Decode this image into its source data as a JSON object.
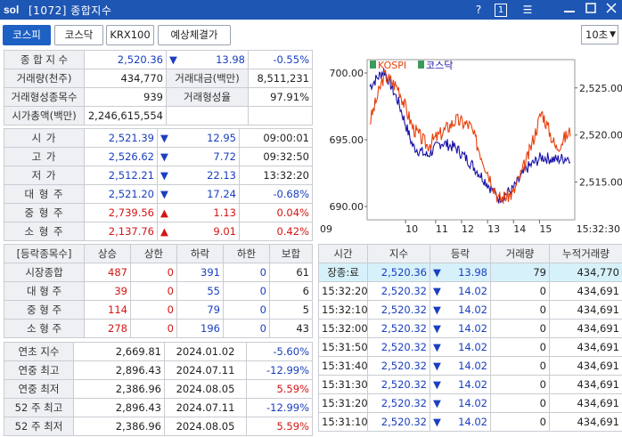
{
  "window": {
    "logo": "sol",
    "title": "[1072] 종합지수",
    "help_icon": "?",
    "one_icon": "1"
  },
  "tabs": [
    "코스피",
    "코스닥",
    "KRX100",
    "예상체결가"
  ],
  "interval": "10초",
  "summary": {
    "r1": {
      "l1": "종 합 지 수",
      "v1": "2,520.36",
      "arrow": "▼",
      "chg": "13.98",
      "pct": "-0.55%"
    },
    "r2": {
      "l1": "거래량(천주)",
      "v1": "434,770",
      "l2": "거래대금(백만)",
      "v2": "8,511,231"
    },
    "r3": {
      "l1": "거래형성종목수",
      "v1": "939",
      "l2": "거래형성율",
      "v2": "97.91%"
    },
    "r4": {
      "l1": "시가총액(백만)",
      "v1": "2,246,615,554"
    }
  },
  "prices": [
    {
      "label": "시    가",
      "val": "2,521.39",
      "arrow": "▼",
      "chg": "12.95",
      "extra": "09:00:01",
      "dir": "dn"
    },
    {
      "label": "고    가",
      "val": "2,526.62",
      "arrow": "▼",
      "chg": "7.72",
      "extra": "09:32:50",
      "dir": "dn"
    },
    {
      "label": "저    가",
      "val": "2,512.21",
      "arrow": "▼",
      "chg": "22.13",
      "extra": "13:32:20",
      "dir": "dn"
    },
    {
      "label": "대 형 주",
      "val": "2,521.20",
      "arrow": "▼",
      "chg": "17.24",
      "extra": "-0.68%",
      "dir": "dn"
    },
    {
      "label": "중 형 주",
      "val": "2,739.56",
      "arrow": "▲",
      "chg": "1.13",
      "extra": "0.04%",
      "dir": "up"
    },
    {
      "label": "소 형 주",
      "val": "2,137.76",
      "arrow": "▲",
      "chg": "9.01",
      "extra": "0.42%",
      "dir": "up"
    }
  ],
  "breadth": {
    "headers": [
      "[등락종목수]",
      "상승",
      "상한",
      "하락",
      "하한",
      "보합"
    ],
    "rows": [
      {
        "label": "시장종합",
        "v": [
          "487",
          "0",
          "391",
          "0",
          "61"
        ]
      },
      {
        "label": "대 형 주",
        "v": [
          "39",
          "0",
          "55",
          "0",
          "6"
        ]
      },
      {
        "label": "중 형 주",
        "v": [
          "114",
          "0",
          "79",
          "0",
          "5"
        ]
      },
      {
        "label": "소 형 주",
        "v": [
          "278",
          "0",
          "196",
          "0",
          "43"
        ]
      }
    ]
  },
  "yearly": [
    {
      "label": "연초  지수",
      "val": "2,669.81",
      "date": "2024.01.02",
      "pct": "-5.60%",
      "dir": "dn"
    },
    {
      "label": "연중  최고",
      "val": "2,896.43",
      "date": "2024.07.11",
      "pct": "-12.99%",
      "dir": "dn"
    },
    {
      "label": "연중  최저",
      "val": "2,386.96",
      "date": "2024.08.05",
      "pct": "5.59%",
      "dir": "up"
    },
    {
      "label": "52 주 최고",
      "val": "2,896.43",
      "date": "2024.07.11",
      "pct": "-12.99%",
      "dir": "dn"
    },
    {
      "label": "52 주 최저",
      "val": "2,386.96",
      "date": "2024.08.05",
      "pct": "5.59%",
      "dir": "up"
    }
  ],
  "ticks": {
    "headers": [
      "시간",
      "지수",
      "등락",
      "거래량",
      "누적거래량"
    ],
    "rows": [
      {
        "t": "장종:료",
        "idx": "2,520.36",
        "arrow": "▼",
        "chg": "13.98",
        "vol": "79",
        "cum": "434,770"
      },
      {
        "t": "15:32:20",
        "idx": "2,520.32",
        "arrow": "▼",
        "chg": "14.02",
        "vol": "0",
        "cum": "434,691"
      },
      {
        "t": "15:32:10",
        "idx": "2,520.32",
        "arrow": "▼",
        "chg": "14.02",
        "vol": "0",
        "cum": "434,691"
      },
      {
        "t": "15:32:00",
        "idx": "2,520.32",
        "arrow": "▼",
        "chg": "14.02",
        "vol": "0",
        "cum": "434,691"
      },
      {
        "t": "15:31:50",
        "idx": "2,520.32",
        "arrow": "▼",
        "chg": "14.02",
        "vol": "0",
        "cum": "434,691"
      },
      {
        "t": "15:31:40",
        "idx": "2,520.32",
        "arrow": "▼",
        "chg": "14.02",
        "vol": "0",
        "cum": "434,691"
      },
      {
        "t": "15:31:30",
        "idx": "2,520.32",
        "arrow": "▼",
        "chg": "14.02",
        "vol": "0",
        "cum": "434,691"
      },
      {
        "t": "15:31:20",
        "idx": "2,520.32",
        "arrow": "▼",
        "chg": "14.02",
        "vol": "0",
        "cum": "434,691"
      },
      {
        "t": "15:31:10",
        "idx": "2,520.32",
        "arrow": "▼",
        "chg": "14.02",
        "vol": "0",
        "cum": "434,691"
      }
    ]
  },
  "chart": {
    "legend": [
      "KOSPI",
      "코스닥"
    ],
    "colors": {
      "kospi": "#e8400c",
      "kosdaq": "#1a12a8"
    },
    "left_ticks": [
      "700.00",
      "695.00",
      "690.00"
    ],
    "right_ticks": [
      "2,525.00",
      "2,520.00",
      "2,515.00"
    ],
    "x_ticks": [
      "09",
      "10",
      "11",
      "12",
      "13",
      "14",
      "15",
      "15:32:30"
    ],
    "left_range": [
      689,
      701
    ],
    "right_range": [
      2511,
      2528
    ]
  },
  "chart_data": {
    "type": "line",
    "x": [
      "09:00",
      "09:30",
      "10:00",
      "10:30",
      "11:00",
      "11:30",
      "12:00",
      "12:30",
      "13:00",
      "13:30",
      "14:00",
      "14:30",
      "15:00",
      "15:20",
      "15:30"
    ],
    "series": [
      {
        "name": "KOSPI",
        "axis": "right",
        "values": [
          2521.4,
          2526.4,
          2525.0,
          2520.8,
          2518.9,
          2520.2,
          2521.6,
          2521.0,
          2517.0,
          2513.2,
          2513.8,
          2517.5,
          2522.5,
          2518.6,
          2520.4
        ]
      },
      {
        "name": "코스닥",
        "axis": "left",
        "values": [
          699.0,
          700.2,
          697.8,
          694.5,
          693.8,
          694.8,
          694.4,
          693.3,
          692.0,
          690.6,
          691.3,
          692.9,
          693.7,
          693.5,
          693.7
        ]
      }
    ]
  }
}
